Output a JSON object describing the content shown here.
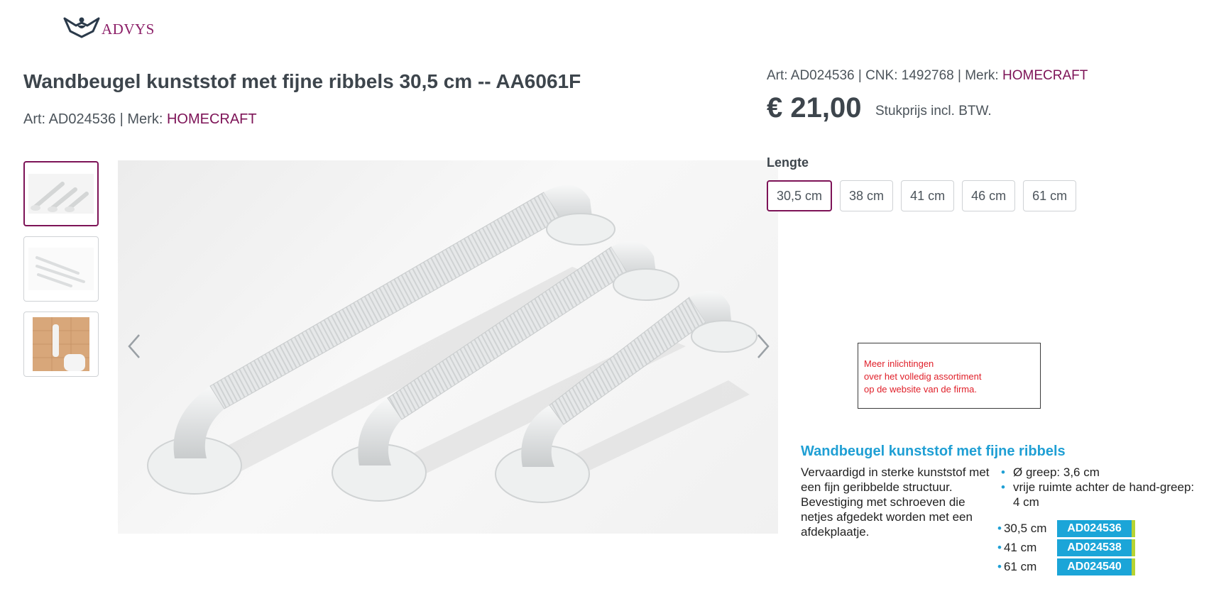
{
  "logo": {
    "text": "ADVYS",
    "icon": "person-arms-raised-logo-icon"
  },
  "product": {
    "title": "Wandbeugel kunststof met fijne ribbels 30,5 cm -- AA6061F",
    "art_prefix": "Art: AD024536 | Merk: ",
    "brand": "HOMECRAFT"
  },
  "gallery": {
    "thumbnails": [
      "three-grab-bars-angle",
      "three-grab-bars-top",
      "grab-bar-on-tile-wall"
    ],
    "active_index": 0,
    "prev_icon": "chevron-left-icon",
    "next_icon": "chevron-right-icon"
  },
  "purchase": {
    "meta_prefix": "Art: AD024536 | CNK: 1492768 | Merk: ",
    "brand": "HOMECRAFT",
    "price": "€ 21,00",
    "price_note": "Stukprijs incl. BTW.",
    "length_label": "Lengte",
    "options": [
      "30,5 cm",
      "38 cm",
      "41 cm",
      "46 cm",
      "61 cm"
    ],
    "selected_option": "30,5 cm"
  },
  "info_box": {
    "line1": "Meer inlichtingen",
    "line2": "over het volledig assortiment",
    "line3": "op de website van de firma."
  },
  "catalog": {
    "title": "Wandbeugel kunststof met fijne ribbels",
    "description": "Vervaardigd in sterke kunststof met een fijn geribbelde structuur. Bevestiging met schroeven die netjes afgedekt worden met een afdekplaatje.",
    "specs": [
      "Ø greep: 3,6 cm",
      "vrije ruimte achter de hand-greep: 4 cm"
    ],
    "codes": [
      {
        "size": "30,5 cm",
        "code": "AD024536"
      },
      {
        "size": "41 cm",
        "code": "AD024538"
      },
      {
        "size": "61 cm",
        "code": "AD024540"
      }
    ]
  },
  "colors": {
    "brand": "#7d1357",
    "accent_blue": "#1ba5d8",
    "info_red": "#e0202a",
    "badge_edge": "#b7d433"
  }
}
